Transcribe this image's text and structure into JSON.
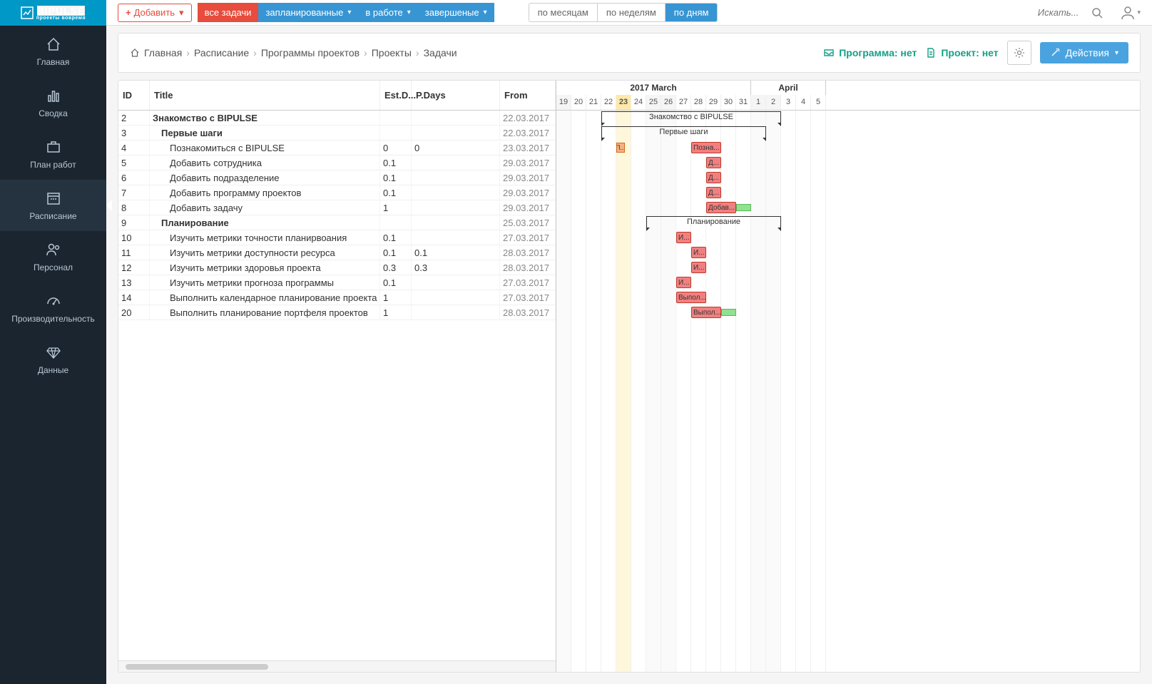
{
  "logo": {
    "main": "BIPULSE",
    "sub": "проекты вовремя"
  },
  "sidebar": {
    "items": [
      {
        "label": "Главная",
        "icon": "home"
      },
      {
        "label": "Сводка",
        "icon": "chart"
      },
      {
        "label": "План работ",
        "icon": "briefcase"
      },
      {
        "label": "Расписание",
        "icon": "calendar"
      },
      {
        "label": "Персонал",
        "icon": "users"
      },
      {
        "label": "Производительность",
        "icon": "gauge"
      },
      {
        "label": "Данные",
        "icon": "diamond"
      }
    ]
  },
  "topbar": {
    "add": "Добавить",
    "filters": [
      {
        "label": "все задачи",
        "kind": "red"
      },
      {
        "label": "запланированные",
        "kind": "blue",
        "chev": true
      },
      {
        "label": "в работе",
        "kind": "blue",
        "chev": true
      },
      {
        "label": "завершеные",
        "kind": "blue",
        "chev": true
      }
    ],
    "views": [
      {
        "label": "по месяцам"
      },
      {
        "label": "по неделям"
      },
      {
        "label": "по дням",
        "active": true
      }
    ],
    "search_placeholder": "Искать..."
  },
  "toolbar": {
    "breadcrumb": [
      "Главная",
      "Расписание",
      "Программы проектов",
      "Проекты",
      "Задачи"
    ],
    "program_label": "Программа: нет",
    "project_label": "Проект: нет",
    "actions_label": "Действия"
  },
  "table": {
    "headers": {
      "id": "ID",
      "title": "Title",
      "est": "Est.D...",
      "pdays": "P.Days",
      "from": "From"
    },
    "rows": [
      {
        "id": "2",
        "title": "Знакомство с BIPULSE",
        "est": "",
        "pdays": "",
        "from": "22.03.2017",
        "indent": 0
      },
      {
        "id": "3",
        "title": "Первые шаги",
        "est": "",
        "pdays": "",
        "from": "22.03.2017",
        "indent": 1
      },
      {
        "id": "4",
        "title": "Познакомиться с BIPULSE",
        "est": "0",
        "pdays": "0",
        "from": "23.03.2017",
        "indent": 2
      },
      {
        "id": "5",
        "title": "Добавить сотрудника",
        "est": "0.1",
        "pdays": "",
        "from": "29.03.2017",
        "indent": 2
      },
      {
        "id": "6",
        "title": "Добавить подразделение",
        "est": "0.1",
        "pdays": "",
        "from": "29.03.2017",
        "indent": 2
      },
      {
        "id": "7",
        "title": "Добавить программу проектов",
        "est": "0.1",
        "pdays": "",
        "from": "29.03.2017",
        "indent": 2
      },
      {
        "id": "8",
        "title": "Добавить задачу",
        "est": "1",
        "pdays": "",
        "from": "29.03.2017",
        "indent": 2
      },
      {
        "id": "9",
        "title": "Планирование",
        "est": "",
        "pdays": "",
        "from": "25.03.2017",
        "indent": 1
      },
      {
        "id": "10",
        "title": "Изучить метрики точности планирвоания",
        "est": "0.1",
        "pdays": "",
        "from": "27.03.2017",
        "indent": 2
      },
      {
        "id": "11",
        "title": "Изучить метрики доступности ресурса",
        "est": "0.1",
        "pdays": "0.1",
        "from": "28.03.2017",
        "indent": 2
      },
      {
        "id": "12",
        "title": "Изучить метрики здоровья проекта",
        "est": "0.3",
        "pdays": "0.3",
        "from": "28.03.2017",
        "indent": 2
      },
      {
        "id": "13",
        "title": "Изучить метрики прогноза программы",
        "est": "0.1",
        "pdays": "",
        "from": "27.03.2017",
        "indent": 2
      },
      {
        "id": "14",
        "title": "Выполнить календарное планирование проекта",
        "est": "1",
        "pdays": "",
        "from": "27.03.2017",
        "indent": 2
      },
      {
        "id": "20",
        "title": "Выполнить планирование портфеля проектов",
        "est": "1",
        "pdays": "",
        "from": "28.03.2017",
        "indent": 2
      }
    ]
  },
  "gantt": {
    "months": [
      {
        "label": "2017 March",
        "span": 13
      },
      {
        "label": "April",
        "span": 5
      }
    ],
    "days": [
      {
        "n": "19",
        "weekend": true
      },
      {
        "n": "20"
      },
      {
        "n": "21"
      },
      {
        "n": "22"
      },
      {
        "n": "23",
        "today": true
      },
      {
        "n": "24"
      },
      {
        "n": "25",
        "weekend": true
      },
      {
        "n": "26",
        "weekend": true
      },
      {
        "n": "27"
      },
      {
        "n": "28"
      },
      {
        "n": "29"
      },
      {
        "n": "30"
      },
      {
        "n": "31"
      },
      {
        "n": "1",
        "weekend": true
      },
      {
        "n": "2",
        "weekend": true
      },
      {
        "n": "3"
      },
      {
        "n": "4"
      },
      {
        "n": "5"
      }
    ],
    "rows": [
      {
        "type": "group",
        "start": 3,
        "span": 12,
        "label": "Знакомство с BIPULSE"
      },
      {
        "type": "group",
        "start": 3,
        "span": 11,
        "label": "Первые шаги"
      },
      {
        "type": "task",
        "start": 9,
        "span": 2,
        "label": "Позна...",
        "pre": {
          "at": 4,
          "label": "П..."
        }
      },
      {
        "type": "task",
        "start": 10,
        "span": 1,
        "label": "Д..."
      },
      {
        "type": "task",
        "start": 10,
        "span": 1,
        "label": "Д..."
      },
      {
        "type": "task",
        "start": 10,
        "span": 1,
        "label": "Д..."
      },
      {
        "type": "task",
        "start": 10,
        "span": 2,
        "label": "Добав...",
        "ext": 1
      },
      {
        "type": "group",
        "start": 6,
        "span": 9,
        "label": "Планирование"
      },
      {
        "type": "task",
        "start": 8,
        "span": 1,
        "label": "И..."
      },
      {
        "type": "task",
        "start": 9,
        "span": 1,
        "label": "И..."
      },
      {
        "type": "task",
        "start": 9,
        "span": 1,
        "label": "И..."
      },
      {
        "type": "task",
        "start": 8,
        "span": 1,
        "label": "И..."
      },
      {
        "type": "task",
        "start": 8,
        "span": 2,
        "label": "Выпол..."
      },
      {
        "type": "task",
        "start": 9,
        "span": 2,
        "label": "Выпол...",
        "ext": 1
      }
    ]
  }
}
